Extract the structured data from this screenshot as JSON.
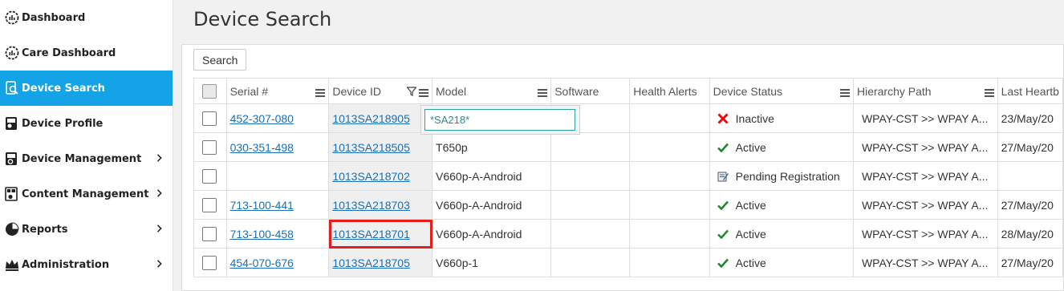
{
  "sidebar": {
    "items": [
      {
        "label": "Dashboard",
        "icon": "gauge-icon",
        "active": false,
        "chevron": false
      },
      {
        "label": "Care Dashboard",
        "icon": "gauge-icon",
        "active": false,
        "chevron": false
      },
      {
        "label": "Device Search",
        "icon": "device-search-icon",
        "active": true,
        "chevron": false
      },
      {
        "label": "Device Profile",
        "icon": "device-profile-icon",
        "active": false,
        "chevron": false
      },
      {
        "label": "Device Management",
        "icon": "device-gear-icon",
        "active": false,
        "chevron": true
      },
      {
        "label": "Content Management",
        "icon": "content-icon",
        "active": false,
        "chevron": true
      },
      {
        "label": "Reports",
        "icon": "pie-chart-icon",
        "active": false,
        "chevron": true
      },
      {
        "label": "Administration",
        "icon": "admin-crown-icon",
        "active": false,
        "chevron": true
      }
    ]
  },
  "page": {
    "title": "Device Search",
    "search_label": "Search"
  },
  "grid": {
    "columns": [
      "Serial #",
      "Device ID",
      "Model",
      "Software",
      "Health Alerts",
      "Device Status",
      "Hierarchy Path",
      "Last Heartb"
    ],
    "rows": [
      {
        "serial": "452-307-080",
        "device_id": "1013SA218905",
        "model": "",
        "software": "",
        "alerts": "",
        "status": "Inactive",
        "status_icon": "cross-icon",
        "hierarchy": "WPAY-CST >> WPAY A...",
        "heartbeat": "23/May/20"
      },
      {
        "serial": "030-351-498",
        "device_id": "1013SA218505",
        "model": "T650p",
        "software": "",
        "alerts": "",
        "status": "Active",
        "status_icon": "check-icon",
        "hierarchy": "WPAY-CST >> WPAY A...",
        "heartbeat": "27/May/20"
      },
      {
        "serial": "",
        "device_id": "1013SA218702",
        "model": "V660p-A-Android",
        "software": "",
        "alerts": "",
        "status": "Pending Registration",
        "status_icon": "pending-icon",
        "hierarchy": "WPAY-CST >> WPAY A...",
        "heartbeat": ""
      },
      {
        "serial": "713-100-441",
        "device_id": "1013SA218703",
        "model": "V660p-A-Android",
        "software": "",
        "alerts": "",
        "status": "Active",
        "status_icon": "check-icon",
        "hierarchy": "WPAY-CST >> WPAY A...",
        "heartbeat": "27/May/20"
      },
      {
        "serial": "713-100-458",
        "device_id": "1013SA218701",
        "model": "V660p-A-Android",
        "software": "",
        "alerts": "",
        "status": "Active",
        "status_icon": "check-icon",
        "hierarchy": "WPAY-CST >> WPAY A...",
        "heartbeat": "28/May/20"
      },
      {
        "serial": "454-070-676",
        "device_id": "1013SA218705",
        "model": "V660p-1",
        "software": "",
        "alerts": "",
        "status": "Active",
        "status_icon": "check-icon",
        "hierarchy": "WPAY-CST >> WPAY A...",
        "heartbeat": "27/May/20"
      }
    ],
    "highlighted_row": 4
  },
  "filter": {
    "value": "*SA218*"
  },
  "colors": {
    "accent": "#13a3e6",
    "link": "#1b6fb3",
    "active_check": "#1e8a2e",
    "inactive_cross": "#e01010",
    "highlight": "#e31e1e"
  }
}
